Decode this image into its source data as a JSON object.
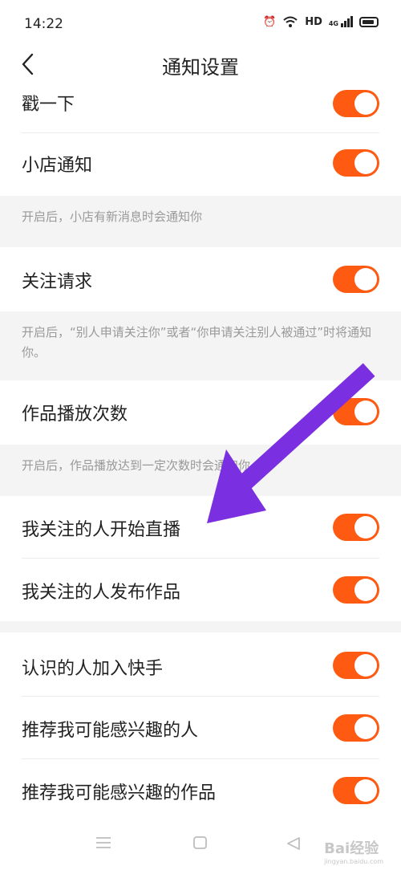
{
  "status": {
    "time": "14:22",
    "alarm_icon": "alarm-icon",
    "wifi_icon": "wifi-icon",
    "hd": "HD",
    "signal_label": "4G"
  },
  "nav": {
    "back_icon": "back-arrow-icon",
    "title": "通知设置"
  },
  "items": {
    "poke": "戳一下",
    "shop": "小店通知",
    "shop_note": "开启后，小店有新消息时会通知你",
    "follow_request": "关注请求",
    "follow_note": "开启后，“别人申请关注你”或者“你申请关注别人被通过”时将通知你。",
    "play_count": "作品播放次数",
    "play_note": "开启后，作品播放达到一定次数时会通知你。",
    "live_start": "我关注的人开始直播",
    "new_work": "我关注的人发布作品",
    "acquaintance": "认识的人加入快手",
    "recommend_people": "推荐我可能感兴趣的人",
    "recommend_works": "推荐我可能感兴趣的作品"
  },
  "toggle_state": "on",
  "colors": {
    "toggle_on": "#fe5a11",
    "arrow": "#7a2fe0",
    "section_bg": "#f4f4f4"
  },
  "system_nav": {
    "menu_icon": "menu-icon",
    "home_icon": "home-icon",
    "back_icon": "back-triangle-icon"
  },
  "watermark": {
    "text": "Bai经验",
    "url": "jingyan.baidu.com"
  }
}
